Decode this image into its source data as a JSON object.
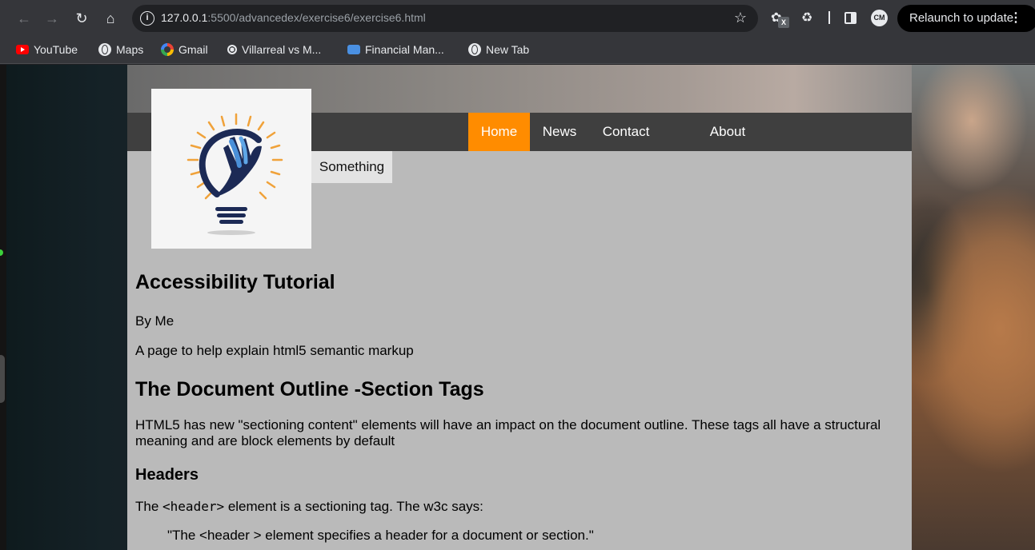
{
  "browser": {
    "url_host": "127.0.0.1",
    "url_path": ":5500/advancedex/exercise6/exercise6.html",
    "profile_initials": "CM",
    "relaunch_label": "Relaunch to update",
    "extension_badge": "X"
  },
  "bookmarks": [
    {
      "label": "YouTube",
      "icon": "youtube-icon"
    },
    {
      "label": "Maps",
      "icon": "globe-icon"
    },
    {
      "label": "Gmail",
      "icon": "google-icon"
    },
    {
      "label": "Villarreal vs M...",
      "icon": "soccer-ball-icon"
    },
    {
      "label": "Financial Man...",
      "icon": "people-icon"
    },
    {
      "label": "New Tab",
      "icon": "globe-icon"
    }
  ],
  "site": {
    "nav": [
      {
        "label": "Home",
        "active": true
      },
      {
        "label": "News",
        "active": false
      },
      {
        "label": "Contact",
        "active": false
      },
      {
        "label": "About",
        "active": false
      }
    ],
    "dropdown_item": "Something",
    "accent_color": "#ff8c00"
  },
  "article": {
    "title": "Accessibility Tutorial",
    "byline": "By Me",
    "subtitle": "A page to help explain html5 semantic markup",
    "section_title": "The Document Outline -Section Tags",
    "section_text": "HTML5 has new \"sectioning content\" elements will have an impact on the document outline. These tags all have a structural meaning and are block elements by default",
    "sub_heading": "Headers",
    "header_text_before": "The ",
    "header_code": "<header>",
    "header_text_after": " element is a sectioning tag. The w3c says:",
    "quote": "\"The <header > element specifies a header for a document or section.\""
  }
}
